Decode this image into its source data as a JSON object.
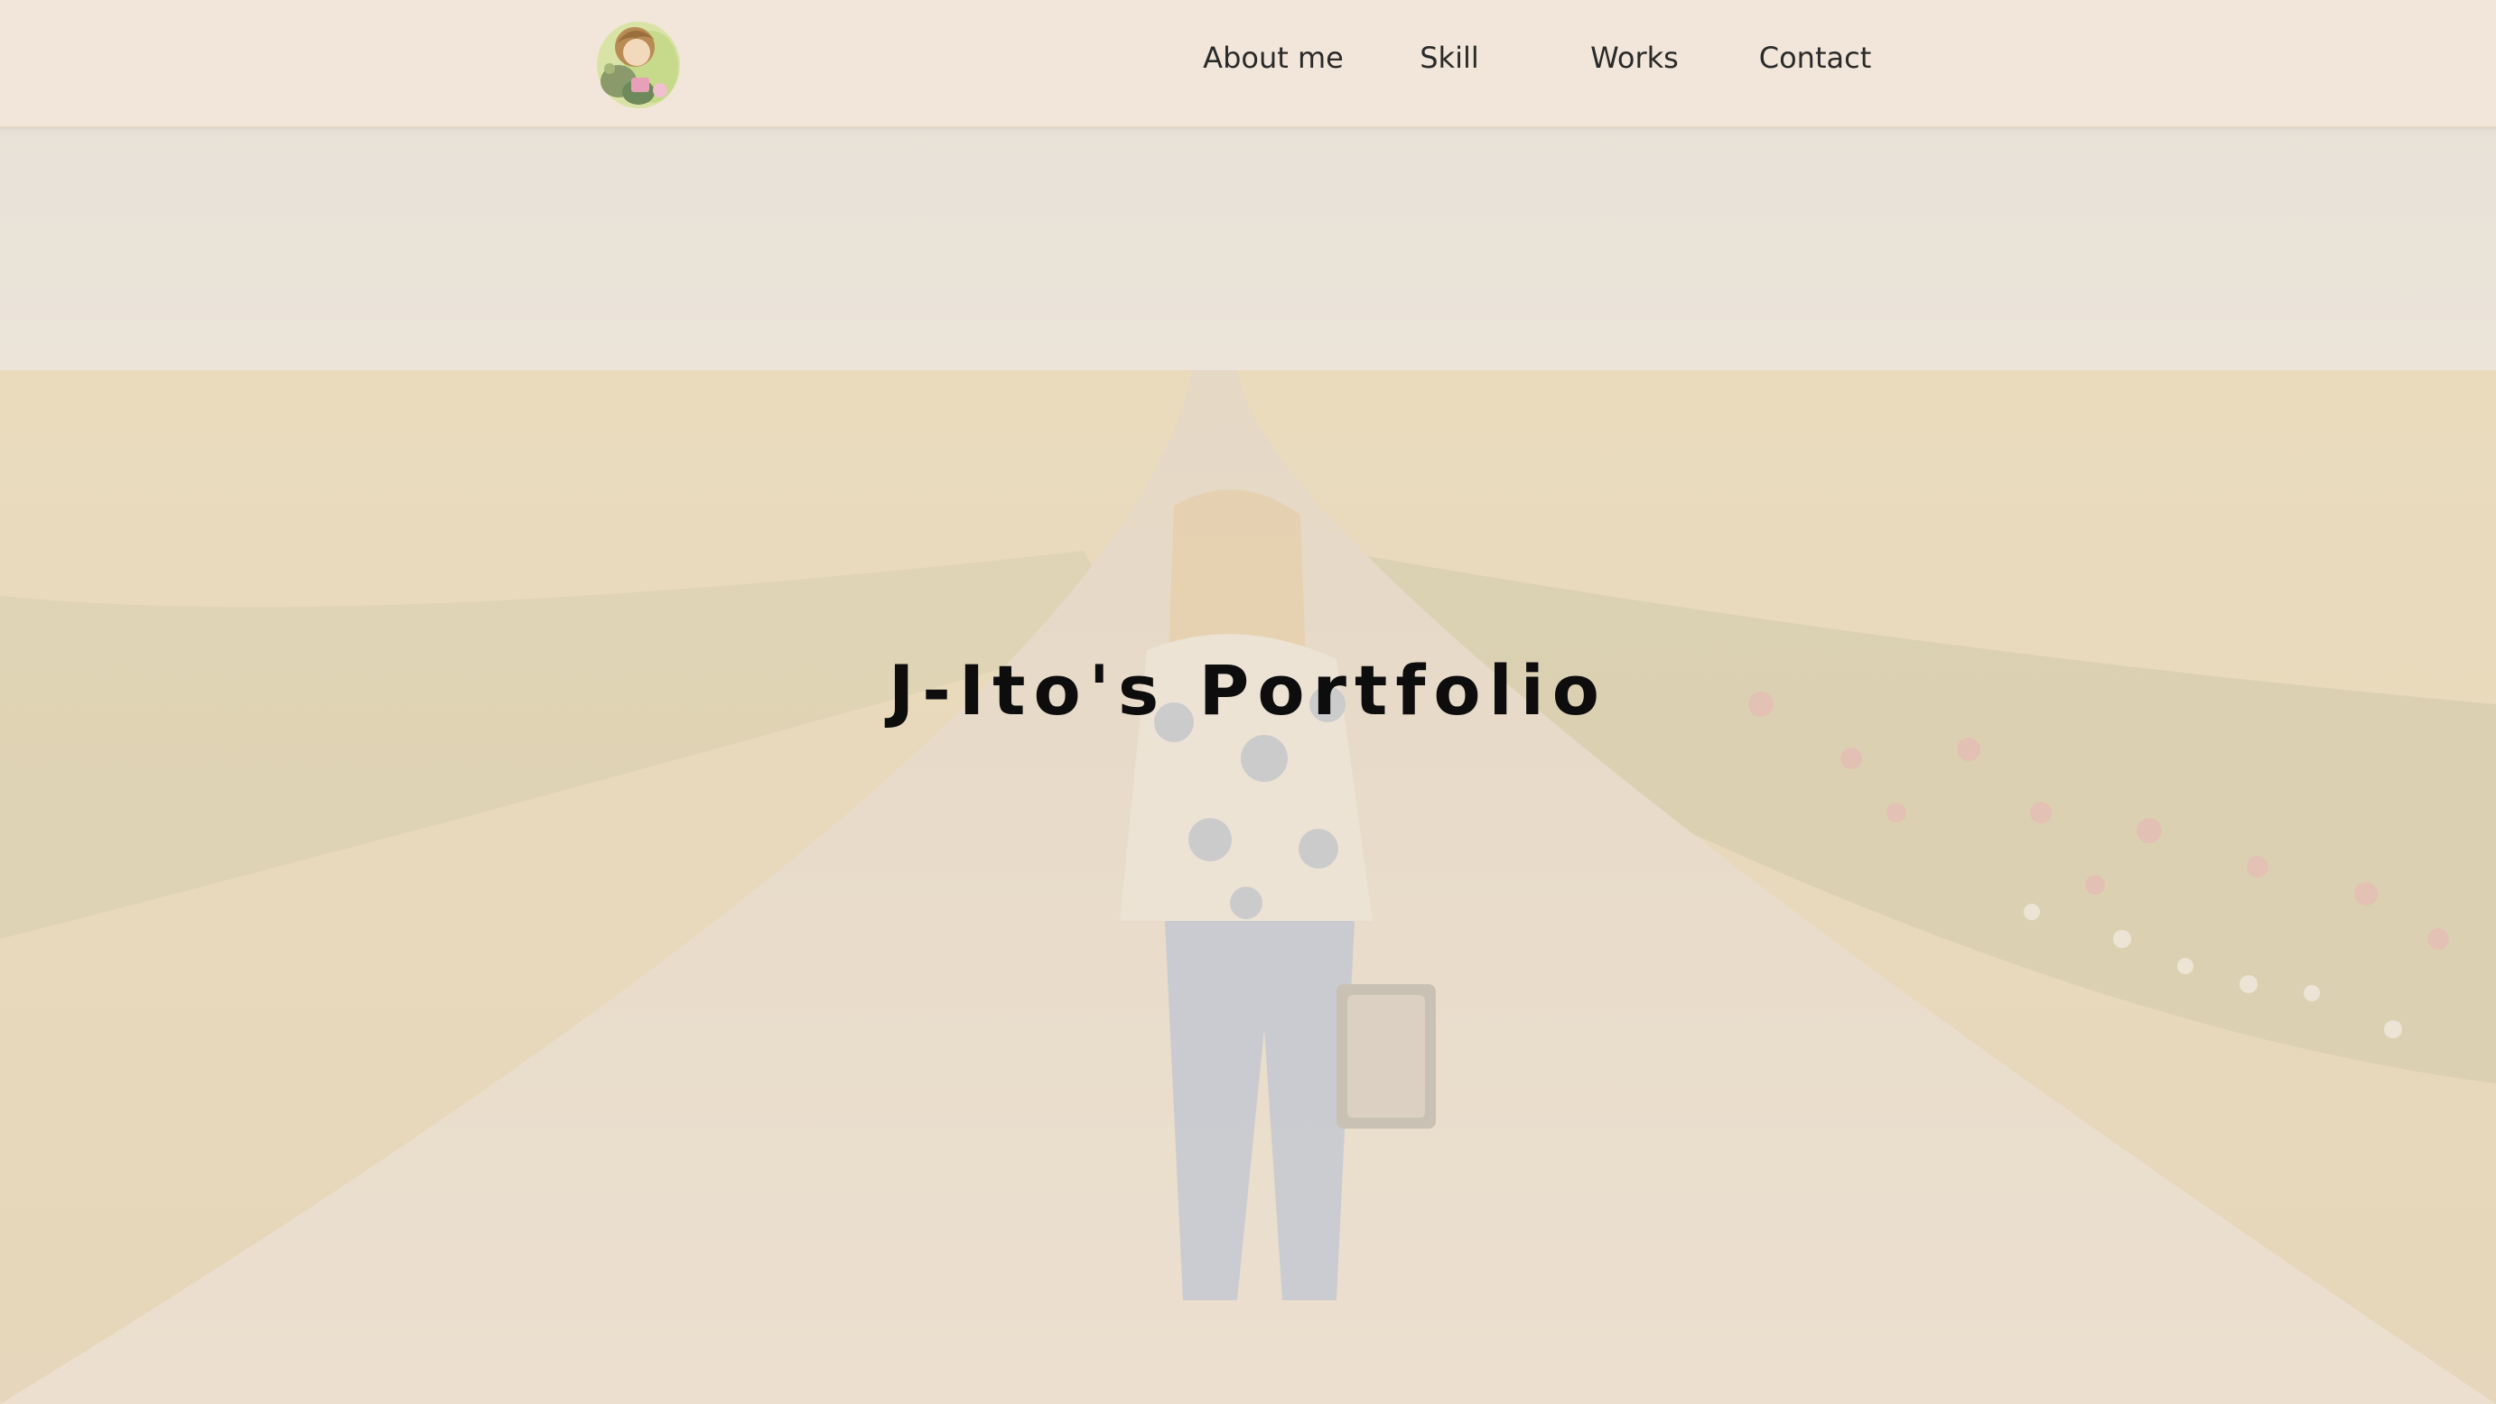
{
  "header": {
    "logo_icon": "portrait-illustration-logo",
    "nav": [
      {
        "label": "About me"
      },
      {
        "label": "Skill"
      },
      {
        "label": "Works"
      },
      {
        "label": "Contact"
      }
    ]
  },
  "hero": {
    "title": "J-Ito's Portfolio",
    "background_image": "woman-walking-on-dirt-road-through-field-photo"
  },
  "colors": {
    "header_bg": "#f1e6d9",
    "overlay": "#f1e6d8",
    "title_text": "#0d0d0d",
    "nav_text": "#2a2a2a"
  }
}
